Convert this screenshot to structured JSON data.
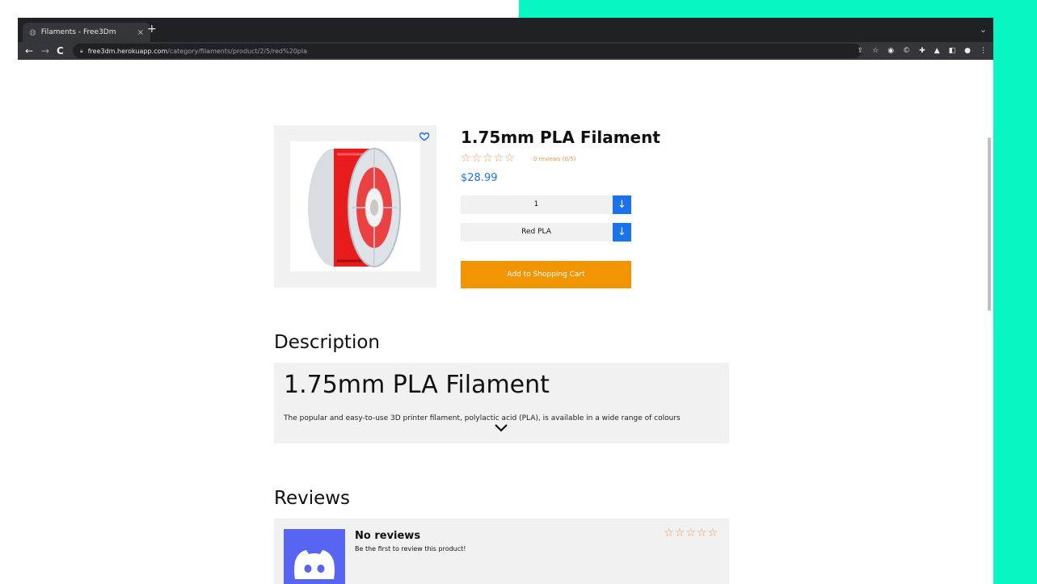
{
  "browser": {
    "tab_title": "Filaments - Free3Dm",
    "tab_close": "×",
    "new_tab": "+",
    "url_host": "free3dm.herokuapp.com",
    "url_path": "/category/filaments/product/2/5/red%20pla",
    "icons": [
      "globe-icon",
      "back-icon",
      "forward-icon",
      "reload-icon",
      "lock-icon",
      "share-icon",
      "bookmark-star-icon",
      "camera-icon",
      "extension-c-icon",
      "puzzle-icon",
      "lab-icon",
      "sidepanel-icon",
      "profile-icon",
      "menu-icon"
    ]
  },
  "product": {
    "title": "1.75mm PLA Filament",
    "rating_stars": "☆☆☆☆☆",
    "rating_value": 0,
    "review_count": "0 reviews (0/5)",
    "price": "$28.99",
    "quantity_value": "1",
    "variant_value": "Red PLA",
    "add_to_cart_label": "Add to Shopping Cart",
    "image_alt": "Red PLA filament spool"
  },
  "description": {
    "heading": "Description",
    "title": "1.75mm PLA Filament",
    "text": "The popular and easy-to-use 3D printer filament, polylactic acid (PLA), is available in a wide range of colours"
  },
  "reviews": {
    "heading": "Reviews",
    "empty_title": "No reviews",
    "empty_subtitle": "Be the first to review this product!",
    "stars": "☆☆☆☆☆"
  },
  "colors": {
    "accent_bg": "#08f7c2",
    "primary_blue": "#1a73e8",
    "cta_orange": "#f29505",
    "star_orange": "#f2994a",
    "avatar_purple": "#5865f2"
  }
}
